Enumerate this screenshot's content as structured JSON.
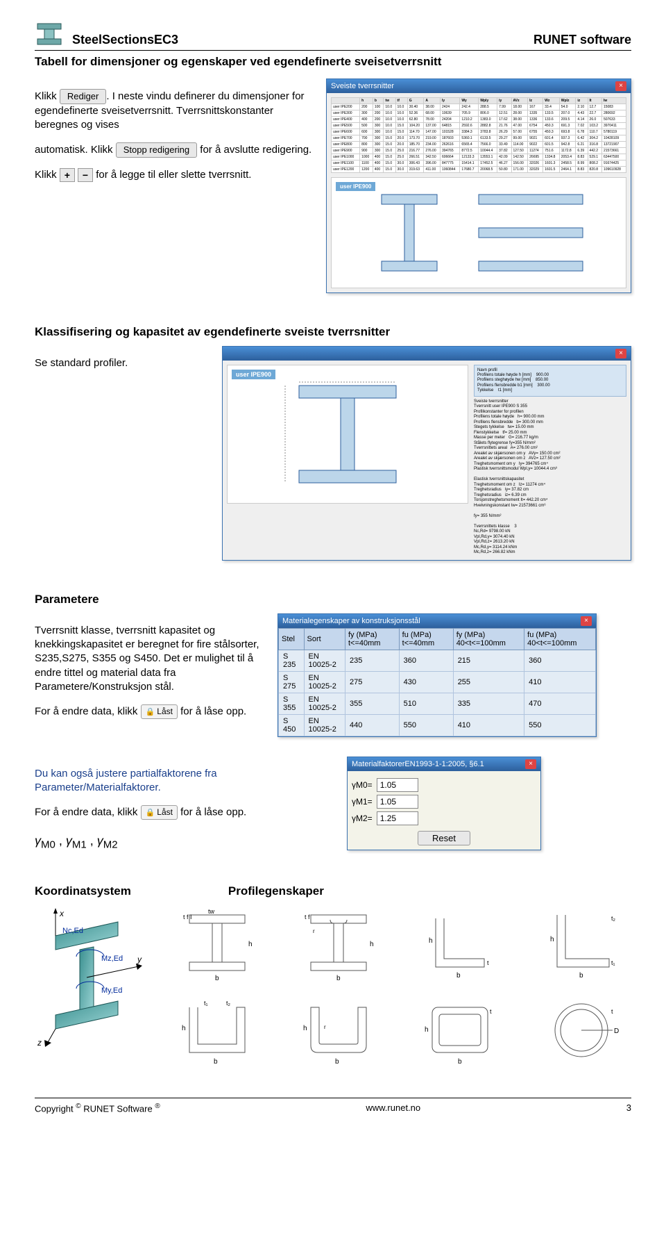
{
  "header": {
    "product": "SteelSectionsEC3",
    "company": "RUNET software"
  },
  "subheading": "Tabell for dimensjoner og egenskaper ved egendefinerte sveisetverrsnitt",
  "section1": {
    "p1_a": "Klikk",
    "btn_rediger": "Rediger",
    "p1_b": ". I neste vindu definerer du dimensjoner for egendefinerte sveisetverrsnitt. Tverrsnittskonstanter beregnes og vises",
    "p2_a": "automatisk. Klikk",
    "btn_stopp": "Stopp redigering",
    "p2_b": "for å avslutte redigering.",
    "p3_a": "Klikk",
    "p3_b": "for å legge til eller slette tverrsnitt.",
    "win_title": "Sveiste tverrsnitter",
    "preview_label": "user IPE900"
  },
  "section2": {
    "heading": "Klassifisering og kapasitet av egendefinerte sveiste tverrsnitter",
    "p": "Se standard profiler.",
    "preview_label": "user IPE900"
  },
  "section3": {
    "heading": "Parametere",
    "p1_a": "Tverrsnitt klasse, tverrsnitt kapasitet og knekkingskapasitet er beregnet for fire stålsorter, S235,S275, S355 og S450. Det er mulighet til å endre tittel og material data fra Parametere/Konstruksjon stål.",
    "p2_a": "For å endre data, klikk",
    "btn_last": "Låst",
    "p2_b": "for å låse opp.",
    "mat_win_title": "Materialegenskaper av konstruksjonsstål",
    "mat_headers": [
      "Stel",
      "Sort",
      "fy (MPa) t<=40mm",
      "fu (MPa) t<=40mm",
      "fy (MPa) 40<t<=100mm",
      "fu (MPa) 40<t<=100mm"
    ],
    "mat_rows": [
      [
        "S 235",
        "EN 10025-2",
        "235",
        "360",
        "215",
        "360"
      ],
      [
        "S 275",
        "EN 10025-2",
        "275",
        "430",
        "255",
        "410"
      ],
      [
        "S 355",
        "EN 10025-2",
        "355",
        "510",
        "335",
        "470"
      ],
      [
        "S 450",
        "EN 10025-2",
        "440",
        "550",
        "410",
        "550"
      ]
    ]
  },
  "section4": {
    "p1": "Du kan også justere partialfaktorene fra Parameter/Materialfaktorer.",
    "p2_a": "For å endre data, klikk",
    "btn_last": "Låst",
    "p2_b": "for å låse opp.",
    "gammas": "γ M0 , γ M1 , γ M2",
    "mf_win_title": "MaterialfaktorerEN1993-1-1:2005, §6.1",
    "mf_rows": [
      {
        "label": "γM0=",
        "value": "1.05"
      },
      {
        "label": "γM1=",
        "value": "1.05"
      },
      {
        "label": "γM2=",
        "value": "1.25"
      }
    ],
    "mf_reset": "Reset"
  },
  "section5": {
    "h_left": "Koordinatsystem",
    "h_right": "Profilegenskaper"
  },
  "footer": {
    "left_a": "Copyright",
    "left_b": "RUNET Software",
    "url": "www.runet.no",
    "page": "3"
  }
}
